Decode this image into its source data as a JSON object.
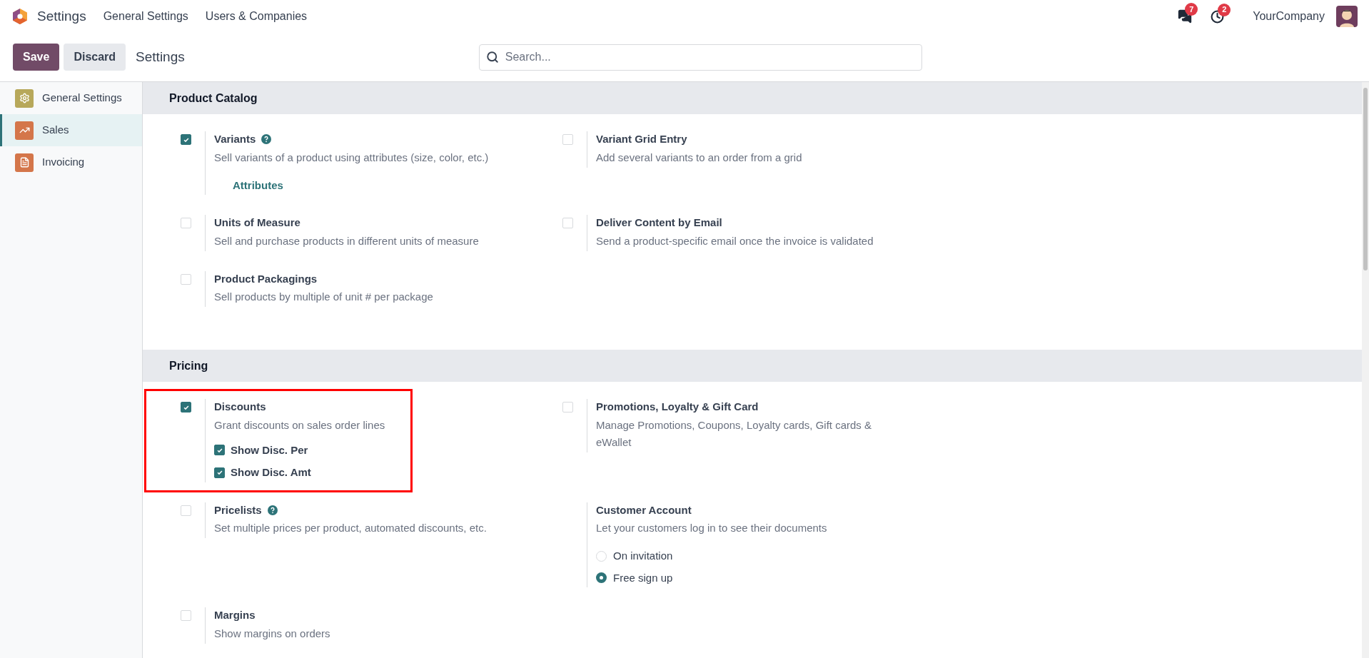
{
  "navbar": {
    "app_title": "Settings",
    "menu": [
      "General Settings",
      "Users & Companies"
    ],
    "messages_count": "7",
    "activities_count": "2",
    "company": "YourCompany"
  },
  "control_panel": {
    "buttons": [
      "Save",
      "Discard"
    ],
    "breadcrumb": "Settings",
    "search": {
      "placeholder": "Search..."
    }
  },
  "sidebar": {
    "items": [
      {
        "label": "General Settings",
        "color": "#b7a85a",
        "selected": false
      },
      {
        "label": "Sales",
        "color": "#d4764a",
        "selected": true
      },
      {
        "label": "Invoicing",
        "color": "#d4764a",
        "selected": false
      }
    ]
  },
  "sections": [
    {
      "title": "Product Catalog",
      "settings": [
        {
          "kind": "checkbox",
          "title": "Variants",
          "help": true,
          "checked": true,
          "highlighted": false,
          "description": "Sell variants of a product using attributes (size, color, etc.)",
          "link": "Attributes"
        },
        {
          "kind": "checkbox",
          "title": "Variant Grid Entry",
          "help": false,
          "checked": false,
          "highlighted": false,
          "description": "Add several variants to an order from a grid"
        },
        {
          "kind": "checkbox",
          "title": "Units of Measure",
          "help": false,
          "checked": false,
          "highlighted": false,
          "description": "Sell and purchase products in different units of measure"
        },
        {
          "kind": "checkbox",
          "title": "Deliver Content by Email",
          "help": false,
          "checked": false,
          "highlighted": false,
          "description": "Send a product-specific email once the invoice is validated"
        },
        {
          "kind": "checkbox",
          "title": "Product Packagings",
          "help": false,
          "checked": false,
          "highlighted": false,
          "description": "Sell products by multiple of unit # per package"
        }
      ]
    },
    {
      "title": "Pricing",
      "settings": [
        {
          "kind": "checkbox",
          "title": "Discounts",
          "help": false,
          "checked": true,
          "highlighted": true,
          "description": "Grant discounts on sales order lines",
          "options": [
            {
              "label": "Show Disc. Per",
              "checked": true
            },
            {
              "label": "Show Disc. Amt",
              "checked": true
            }
          ]
        },
        {
          "kind": "checkbox",
          "title": "Promotions, Loyalty & Gift Card",
          "help": false,
          "checked": false,
          "highlighted": false,
          "description": "Manage Promotions, Coupons, Loyalty cards, Gift cards & eWallet"
        },
        {
          "kind": "checkbox",
          "title": "Pricelists",
          "help": true,
          "checked": false,
          "highlighted": false,
          "description": "Set multiple prices per product, automated discounts, etc."
        },
        {
          "kind": "radio",
          "title": "Customer Account",
          "help": false,
          "highlighted": false,
          "description": "Let your customers log in to see their documents",
          "choices": [
            {
              "label": "On invitation",
              "selected": false
            },
            {
              "label": "Free sign up",
              "selected": true
            }
          ]
        },
        {
          "kind": "checkbox",
          "title": "Margins",
          "help": false,
          "checked": false,
          "highlighted": false,
          "description": "Show margins on orders"
        }
      ]
    }
  ]
}
